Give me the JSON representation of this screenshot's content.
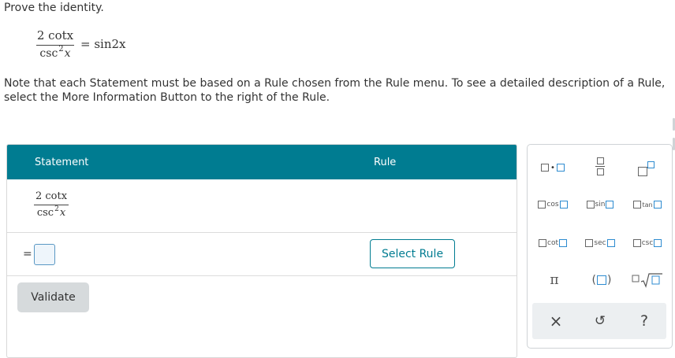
{
  "prompt": {
    "instruction": "Prove the identity.",
    "identity": {
      "numerator": "2 cotx",
      "denominator_base": "csc",
      "denominator_exp": "2",
      "denominator_var": "x",
      "rhs": "= sin2x"
    }
  },
  "note": {
    "line1": "Note that each Statement must be based on a Rule chosen from the Rule menu. To see a detailed description of a Rule, ",
    "line2": "select the More Information Button to the right of the Rule."
  },
  "table": {
    "header_statement": "Statement",
    "header_rule": "Rule",
    "row1": {
      "numerator": "2 cotx",
      "denominator_base": "csc",
      "denominator_exp": "2",
      "denominator_var": "x"
    },
    "row2": {
      "equals": "=",
      "select_rule_label": "Select Rule"
    },
    "validate_label": "Validate"
  },
  "palette": {
    "trig": [
      "cos",
      "sin",
      "tan",
      "cot",
      "sec",
      "csc"
    ],
    "pi": "π",
    "footer": {
      "clear": "×",
      "undo": "↺",
      "help": "?"
    }
  },
  "colors": {
    "header": "#007c91",
    "accent": "#007c91",
    "input_border": "#5a98c4"
  }
}
